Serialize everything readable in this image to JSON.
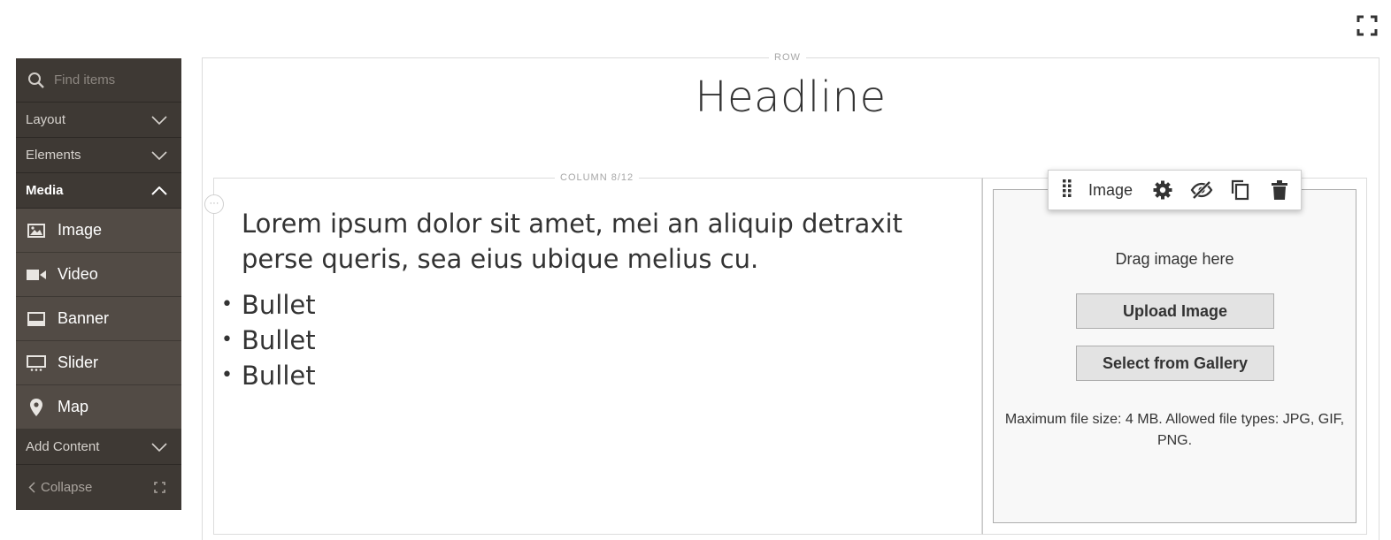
{
  "sidebar": {
    "search_placeholder": "Find items",
    "sections": {
      "layout": "Layout",
      "elements": "Elements",
      "media": "Media",
      "add_content": "Add Content"
    },
    "media_items": [
      "Image",
      "Video",
      "Banner",
      "Slider",
      "Map"
    ],
    "collapse_label": "Collapse"
  },
  "stage": {
    "row_label": "ROW",
    "headline": "Headline",
    "column_label": "COLUMN 8/12",
    "column_handle": "···",
    "paragraph": "Lorem ipsum dolor sit amet, mei an aliquip detraxit perse queris, sea eius ubique melius cu.",
    "bullet_marker": "•",
    "bullets": [
      "Bullet",
      "Bullet",
      "Bullet"
    ]
  },
  "image_element": {
    "toolbar_label": "Image",
    "drag_text": "Drag image here",
    "upload_button": "Upload Image",
    "gallery_button": "Select from Gallery",
    "note": "Maximum file size: 4 MB. Allowed file types: JPG, GIF, PNG."
  },
  "icons": {
    "search": "search-icon",
    "chevron": "chevron-down-icon",
    "fullscreen": "fullscreen-icon",
    "drag_handle": "drag-handle-icon",
    "settings": "gear-icon",
    "hide": "eye-slash-icon",
    "duplicate": "copy-icon",
    "remove": "trash-icon"
  },
  "colors": {
    "panel_bg": "#3e3934",
    "media_item_bg": "#524b45",
    "button_bg": "#e3e3e3"
  }
}
